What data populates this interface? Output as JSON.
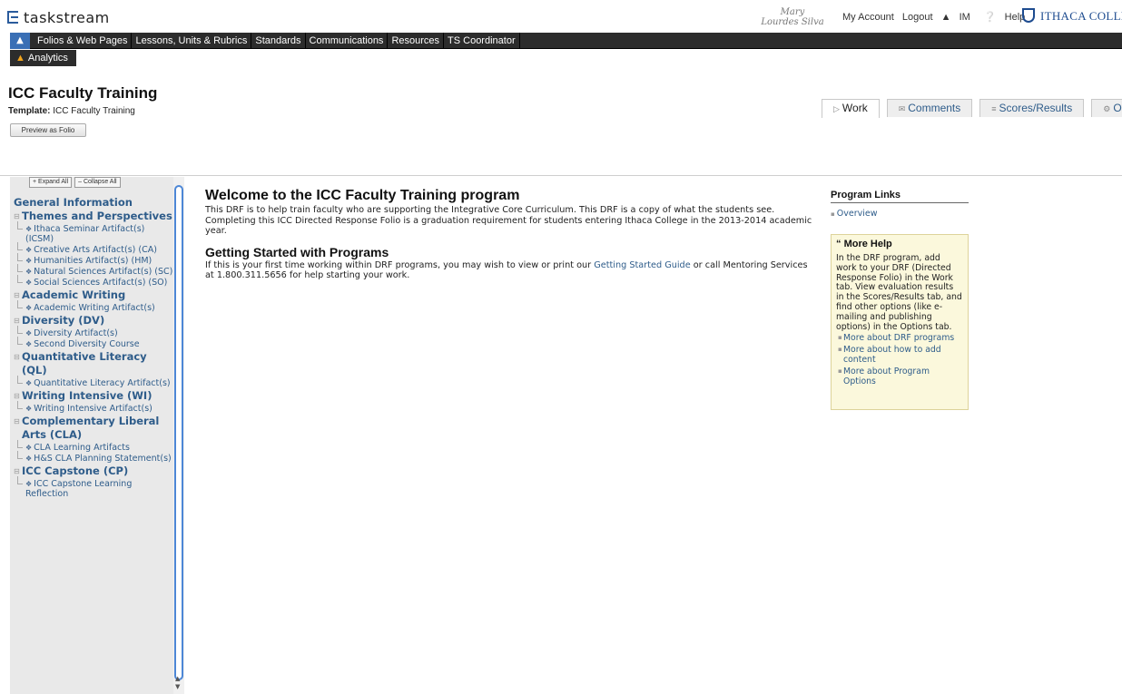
{
  "app": {
    "logo": "taskstream",
    "brand": "ITHACA COLLEGE"
  },
  "user": {
    "name": "Mary Lourdes Silva"
  },
  "toplinks": {
    "account": "My Account",
    "logout": "Logout",
    "im": "IM",
    "help": "Help"
  },
  "nav": {
    "items": [
      "Folios & Web Pages",
      "Lessons, Units & Rubrics",
      "Standards",
      "Communications",
      "Resources",
      "TS Coordinator"
    ],
    "analytics": "Analytics"
  },
  "page": {
    "title": "ICC Faculty Training",
    "template_label": "Template:",
    "template_value": "ICC Faculty Training",
    "preview_button": "Preview as Folio"
  },
  "tabs": [
    {
      "label": "Work",
      "icon": "document-icon"
    },
    {
      "label": "Comments",
      "icon": "comments-icon"
    },
    {
      "label": "Scores/Results",
      "icon": "scores-icon"
    },
    {
      "label": "Options",
      "icon": "options-icon"
    }
  ],
  "sidebar": {
    "expand_all": "Expand All",
    "collapse_all": "Collapse All",
    "general": "General Information",
    "sections": [
      {
        "title": "Themes and Perspectives",
        "items": [
          "Ithaca Seminar Artifact(s) (ICSM)",
          "Creative Arts Artifact(s) (CA)",
          "Humanities Artifact(s) (HM)",
          "Natural Sciences Artifact(s) (SC)",
          "Social Sciences Artifact(s) (SO)"
        ]
      },
      {
        "title": "Academic Writing",
        "items": [
          "Academic Writing Artifact(s)"
        ]
      },
      {
        "title": "Diversity (DV)",
        "items": [
          "Diversity Artifact(s)",
          "Second Diversity Course"
        ]
      },
      {
        "title": "Quantitative Literacy (QL)",
        "items": [
          "Quantitative Literacy Artifact(s)"
        ]
      },
      {
        "title": "Writing Intensive (WI)",
        "items": [
          "Writing Intensive Artifact(s)"
        ]
      },
      {
        "title": "Complementary Liberal Arts (CLA)",
        "items": [
          "CLA Learning Artifacts",
          "H&S CLA Planning Statement(s)"
        ]
      },
      {
        "title": "ICC Capstone (CP)",
        "items": [
          "ICC Capstone Learning Reflection"
        ]
      }
    ]
  },
  "main": {
    "heading": "Welcome to the ICC Faculty Training program",
    "intro": "This DRF is to help train faculty who are supporting the Integrative Core Curriculum. This DRF is a copy of what the students see. Completing this ICC Directed Response Folio is a graduation requirement for students entering Ithaca College in the 2013-2014 academic year.",
    "subheading": "Getting Started with Programs",
    "gs_before": "If this is your first time working within DRF programs, you may wish to view or print our ",
    "gs_link": "Getting Started Guide",
    "gs_after": " or call Mentoring Services at 1.800.311.5656 for help starting your work."
  },
  "program_links": {
    "title": "Program Links",
    "overview": "Overview"
  },
  "more_help": {
    "title": "More Help",
    "text": "In the DRF program, add work to your DRF (Directed Response Folio) in the Work tab. View evaluation results in the Scores/Results tab, and find other options (like e-mailing and publishing options) in the Options tab.",
    "links": [
      "More about DRF programs",
      "More about how to add content",
      "More about Program Options"
    ]
  },
  "colors": {
    "link": "#2e5c8a",
    "nav_bg": "#2c2c2c",
    "home": "#3a6fb5",
    "help_bg": "#fbf8dc"
  }
}
